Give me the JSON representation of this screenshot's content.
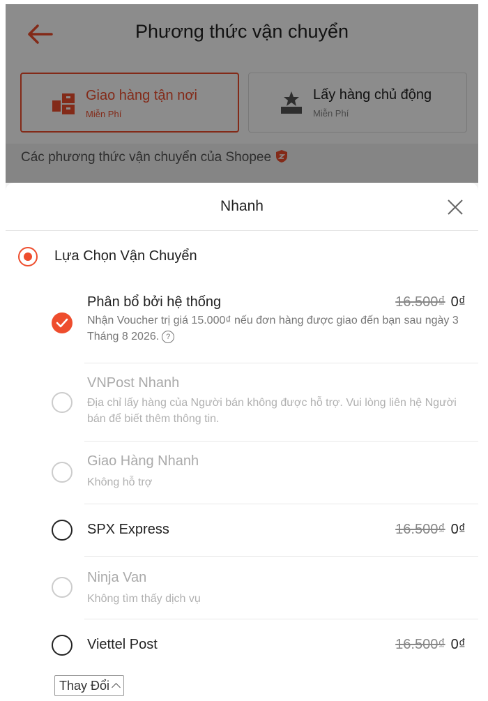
{
  "header": {
    "title": "Phương thức vận chuyển"
  },
  "options": [
    {
      "name": "Giao hàng tận nơi",
      "sub": "Miễn Phí",
      "selected": true,
      "icon": "delivery-box-icon"
    },
    {
      "name": "Lấy hàng chủ động",
      "sub": "Miễn Phí",
      "selected": false,
      "icon": "pickup-star-icon"
    }
  ],
  "section_label": "Các phương thức vận chuyển của Shopee",
  "sheet": {
    "title": "Nhanh",
    "choice_label": "Lựa Chọn Vận Chuyển",
    "carriers": [
      {
        "name": "Phân bổ bởi hệ thống",
        "desc": "Nhận Voucher trị giá 15.000₫ nếu đơn hàng được giao đến bạn sau ngày 3 Tháng 8 2026.",
        "old_price": "16.500₫",
        "new_price": "0₫",
        "state": "selected"
      },
      {
        "name": "VNPost Nhanh",
        "desc": "Địa chỉ lấy hàng của Người bán không được hỗ trợ. Vui lòng liên hệ Người bán để biết thêm thông tin.",
        "state": "disabled"
      },
      {
        "name": "Giao Hàng Nhanh",
        "desc": "Không hỗ trợ",
        "state": "disabled"
      },
      {
        "name": "SPX Express",
        "old_price": "16.500₫",
        "new_price": "0₫",
        "state": "available"
      },
      {
        "name": "Ninja Van",
        "desc": "Không tìm thấy dịch vụ",
        "state": "disabled"
      },
      {
        "name": "Viettel Post",
        "old_price": "16.500₫",
        "new_price": "0₫",
        "state": "available"
      }
    ],
    "change_button": "Thay Đổi"
  },
  "colors": {
    "accent": "#ee4d2d",
    "overlay": "rgba(0,0,0,0.45)"
  }
}
